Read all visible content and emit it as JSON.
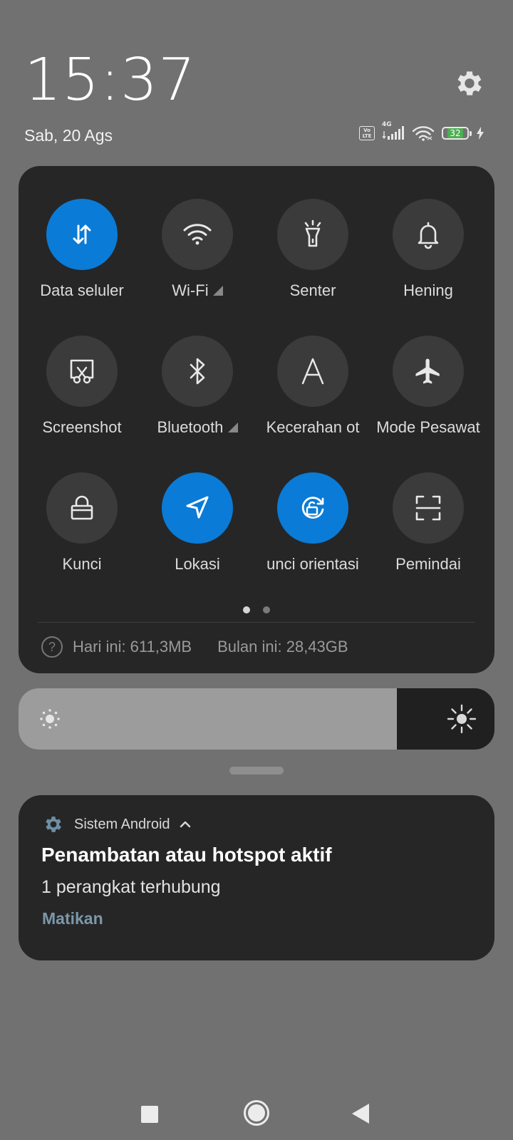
{
  "header": {
    "time": "15:37",
    "date": "Sab, 20 Ags"
  },
  "status_bar": {
    "volte_line1": "Vo",
    "volte_line2": "LTE",
    "network": "4G",
    "battery_level": "32",
    "icons": [
      "volte-icon",
      "signal-icon",
      "wifi-icon",
      "battery-icon",
      "charging-icon"
    ]
  },
  "tiles": [
    {
      "label": "Data seluler",
      "icon": "data-icon",
      "active": true
    },
    {
      "label": "Wi-Fi",
      "icon": "wifi-icon",
      "active": false
    },
    {
      "label": "Senter",
      "icon": "flashlight-icon",
      "active": false
    },
    {
      "label": "Hening",
      "icon": "bell-icon",
      "active": false
    },
    {
      "label": "Screenshot",
      "icon": "screenshot-icon",
      "active": false
    },
    {
      "label": "Bluetooth",
      "icon": "bluetooth-icon",
      "active": false
    },
    {
      "label": "Kecerahan ot",
      "icon": "auto-brightness-icon",
      "active": false
    },
    {
      "label": "Mode Pesawat",
      "icon": "airplane-icon",
      "active": false
    },
    {
      "label": "Kunci",
      "icon": "lock-icon",
      "active": false
    },
    {
      "label": "Lokasi",
      "icon": "location-icon",
      "active": true
    },
    {
      "label": "unci orientasi",
      "icon": "rotation-lock-icon",
      "active": true
    },
    {
      "label": "Pemindai",
      "icon": "scanner-icon",
      "active": false
    }
  ],
  "page_indicator": {
    "pages": 2,
    "current": 1
  },
  "data_usage": {
    "help_glyph": "?",
    "today": "Hari ini: 611,3MB",
    "month": "Bulan ini: 28,43GB"
  },
  "brightness": {
    "level": 0.795
  },
  "notification": {
    "app_name": "Sistem Android",
    "title": "Penambatan atau hotspot aktif",
    "text": "1 perangkat terhubung",
    "action": "Matikan"
  },
  "colors": {
    "accent": "#0a7bd6",
    "panel": "#262626",
    "background": "#717171",
    "action": "#7c97aa"
  }
}
